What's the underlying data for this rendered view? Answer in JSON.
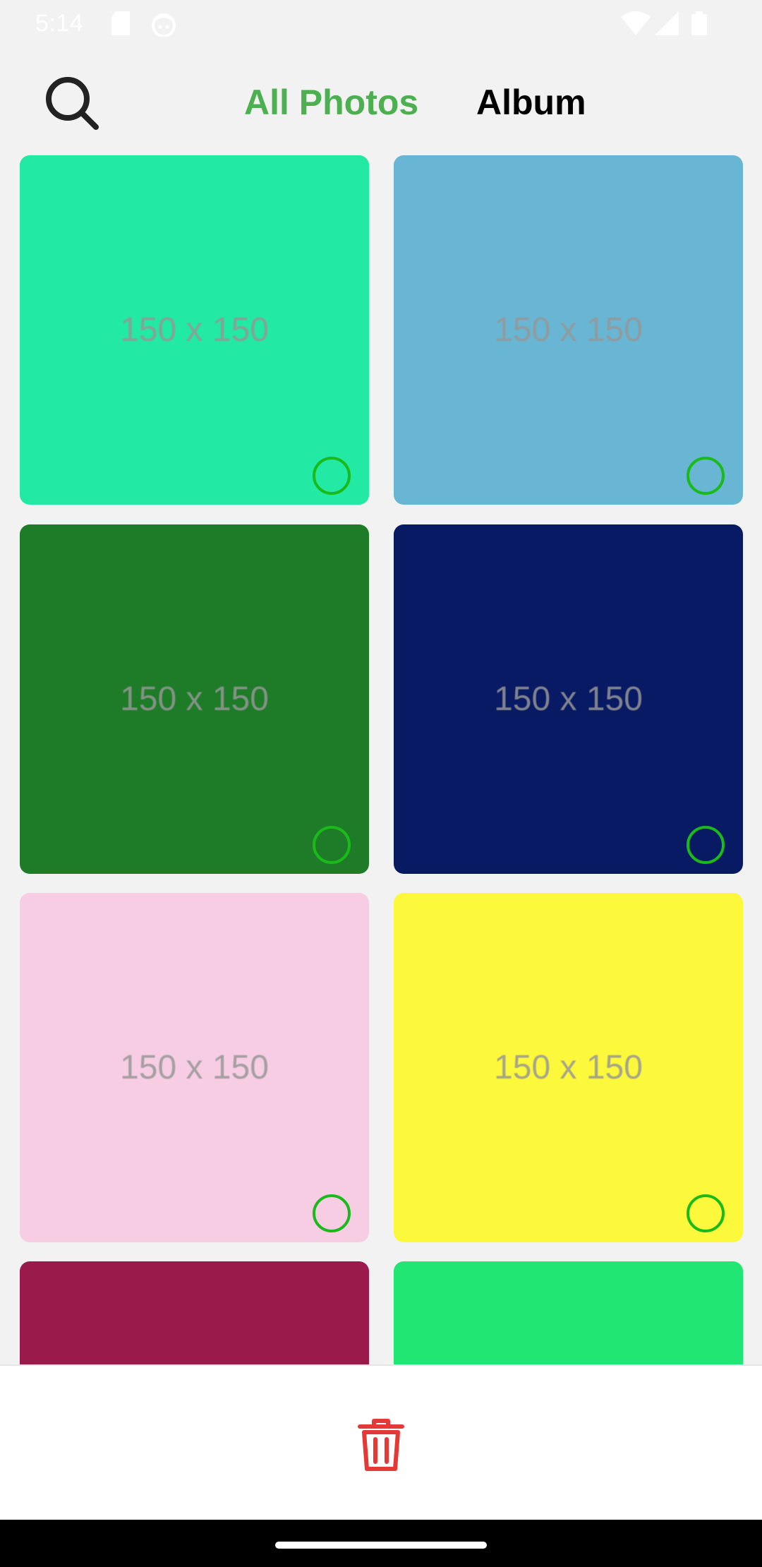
{
  "status_bar": {
    "time": "5:14",
    "icons": [
      "sd-card-icon",
      "android-head-icon",
      "wifi-icon",
      "signal-icon",
      "battery-icon"
    ]
  },
  "header": {
    "search_icon": "search-icon",
    "tabs": [
      {
        "label": "All Photos",
        "selected": true
      },
      {
        "label": "Album",
        "selected": false
      }
    ]
  },
  "colors": {
    "accent": "#4caf50",
    "select_ring": "#1aba1a",
    "delete": "#e53935"
  },
  "photos": [
    {
      "label": "150 x 150",
      "color": "#22e9a4",
      "selected": false
    },
    {
      "label": "150 x 150",
      "color": "#68b6d3",
      "selected": false
    },
    {
      "label": "150 x 150",
      "color": "#1e7c29",
      "selected": false
    },
    {
      "label": "150 x 150",
      "color": "#081a63",
      "selected": false
    },
    {
      "label": "150 x 150",
      "color": "#f7cde4",
      "selected": false
    },
    {
      "label": "150 x 150",
      "color": "#fcf83c",
      "selected": false
    },
    {
      "label": "",
      "color": "#9a1a4b",
      "selected": false
    },
    {
      "label": "",
      "color": "#22e674",
      "selected": false
    }
  ],
  "bottom_bar": {
    "delete_icon": "trash-icon"
  }
}
